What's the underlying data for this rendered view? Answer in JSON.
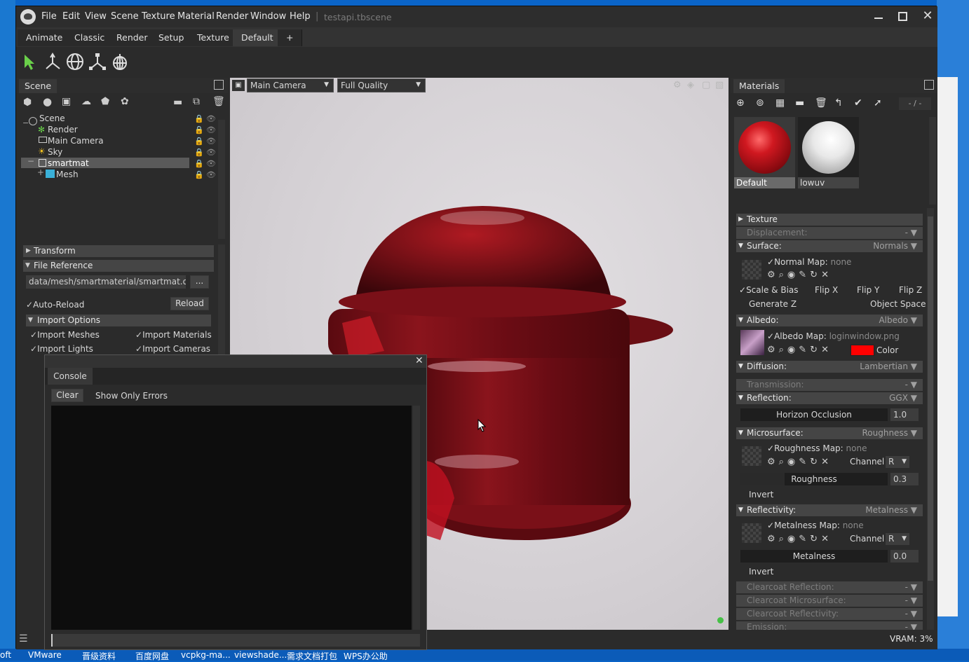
{
  "window": {
    "file_name": "testapi.tbscene",
    "menu": [
      "File",
      "Edit",
      "View",
      "Scene",
      "Texture",
      "Material",
      "Render",
      "Window",
      "Help"
    ],
    "tabs": [
      "Animate",
      "Classic",
      "Render",
      "Setup",
      "Texture",
      "Default",
      "+"
    ],
    "active_tab": "Default"
  },
  "toolbar": {
    "tools": [
      "select-arrow-icon",
      "move-axes-icon",
      "rotate-globe-icon",
      "scale-axes-icon",
      "pivot-sphere-icon"
    ]
  },
  "scene_panel": {
    "title": "Scene",
    "tree": [
      {
        "label": "Scene",
        "icon": "globe-icon"
      },
      {
        "label": "Render",
        "icon": "gear-icon"
      },
      {
        "label": "Main Camera",
        "icon": "camera-icon"
      },
      {
        "label": "Sky",
        "icon": "sun-icon"
      },
      {
        "label": "smartmat",
        "icon": "object-icon"
      },
      {
        "label": "Mesh",
        "icon": "cube-icon"
      }
    ],
    "selected_item": "smartmat"
  },
  "properties": {
    "transform_label": "Transform",
    "file_reference_label": "File Reference",
    "file_path": "data/mesh/smartmaterial/smartmat.obj",
    "browse_label": "...",
    "auto_reload_label": "Auto-Reload",
    "reload_label": "Reload",
    "import_options_label": "Import Options",
    "import_meshes": "Import Meshes",
    "import_materials": "Import Materials",
    "import_lights": "Import Lights",
    "import_cameras": "Import Cameras"
  },
  "viewport": {
    "camera": "Main Camera",
    "quality": "Full Quality"
  },
  "console": {
    "title": "Console",
    "clear_label": "Clear",
    "show_errors_label": "Show Only Errors",
    "input_value": ""
  },
  "materials_panel": {
    "title": "Materials",
    "counter": "- / -",
    "thumbnails": [
      {
        "name": "Default",
        "selected": true
      },
      {
        "name": "lowuv",
        "selected": false
      }
    ],
    "texture_label": "Texture",
    "displacement_label": "Displacement:",
    "displacement_value": "-",
    "surface_label": "Surface:",
    "surface_value": "Normals",
    "normal_map_label": "Normal Map:",
    "normal_map_value": "none",
    "scale_bias": "Scale & Bias",
    "flip_x": "Flip X",
    "flip_y": "Flip Y",
    "flip_z": "Flip Z",
    "generate_z": "Generate Z",
    "object_space": "Object Space",
    "albedo_label": "Albedo:",
    "albedo_value": "Albedo",
    "albedo_map_label": "Albedo Map:",
    "albedo_map_value": "loginwindow.png",
    "color_label": "Color",
    "albedo_color": "#ff0000",
    "diffusion_label": "Diffusion:",
    "diffusion_value": "Lambertian",
    "transmission_label": "Transmission:",
    "transmission_value": "-",
    "reflection_label": "Reflection:",
    "reflection_value": "GGX",
    "horizon_label": "Horizon Occlusion",
    "horizon_value": "1.0",
    "microsurface_label": "Microsurface:",
    "microsurface_value": "Roughness",
    "roughness_map_label": "Roughness Map:",
    "roughness_map_value": "none",
    "channel_label": "Channel",
    "channel_r": "R",
    "roughness_label": "Roughness",
    "roughness_value": "0.3",
    "invert_label": "Invert",
    "reflectivity_label": "Reflectivity:",
    "reflectivity_value": "Metalness",
    "metalness_map_label": "Metalness Map:",
    "metalness_map_value": "none",
    "metalness_label": "Metalness",
    "metalness_value": "0.0",
    "clearcoat_reflection": "Clearcoat Reflection:",
    "clearcoat_microsurface": "Clearcoat Microsurface:",
    "clearcoat_reflectivity": "Clearcoat Reflectivity:",
    "emission": "Emission:"
  },
  "status": {
    "vram": "VRAM: 3%"
  },
  "taskbar": {
    "items": [
      "oft",
      "VMware",
      "晋级资料",
      "百度网盘",
      "vcpkg-ma...",
      "viewshade...",
      "需求文档打包",
      "WPS办公助"
    ]
  }
}
